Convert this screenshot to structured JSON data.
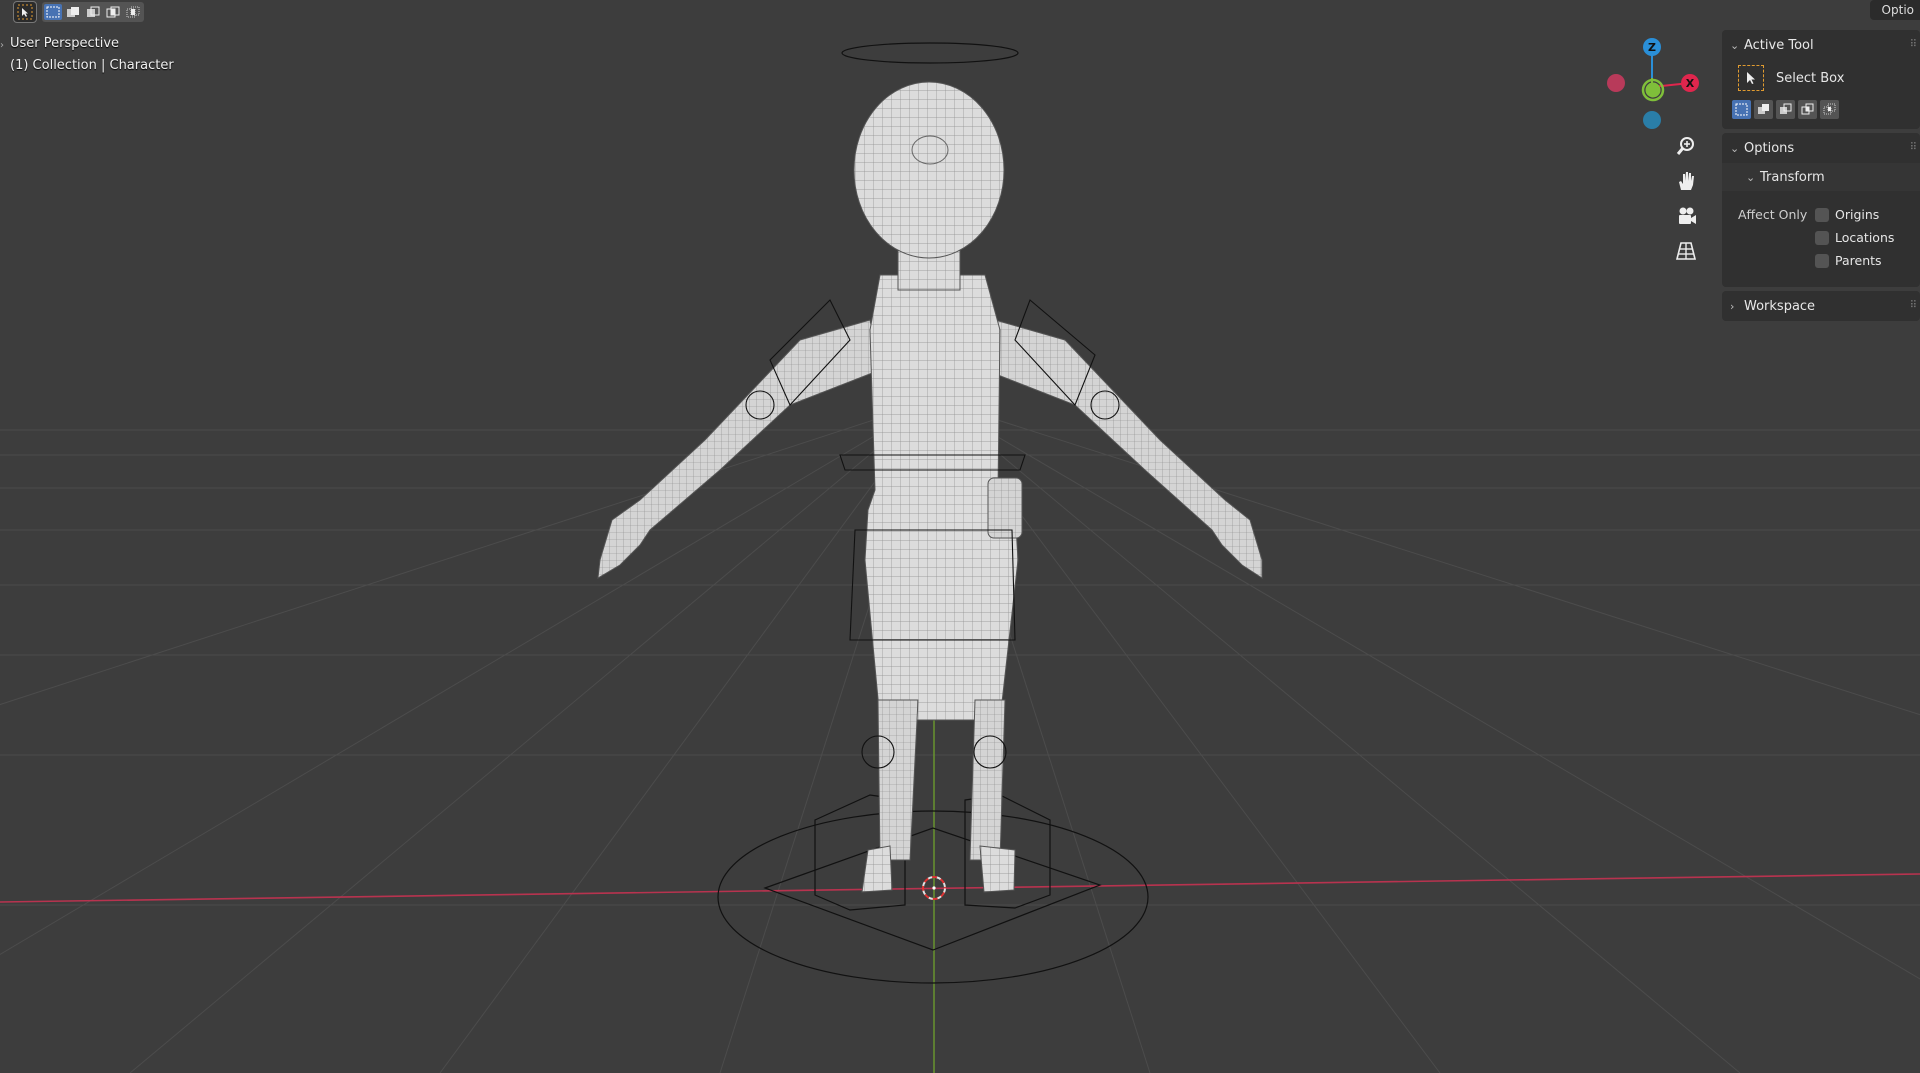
{
  "header": {
    "options_label": "Optio"
  },
  "overlay": {
    "view_name": "User Perspective",
    "collection_info": "(1) Collection | Character"
  },
  "gizmo": {
    "axes": {
      "z": "Z",
      "x": "X"
    },
    "colors": {
      "x": "#e0264d",
      "y": "#7fbf3a",
      "z": "#2a8fd8",
      "x_neg": "#b83a5a",
      "z_neg": "#2a7ea8"
    }
  },
  "navigation": {
    "icons": [
      "zoom-icon",
      "hand-pan-icon",
      "camera-icon",
      "perspective-grid-icon"
    ]
  },
  "sidebar": {
    "active_tool": {
      "title": "Active Tool",
      "tool_name": "Select Box"
    },
    "options": {
      "title": "Options",
      "transform": {
        "title": "Transform",
        "affect_only_label": "Affect Only",
        "checkboxes": [
          {
            "label": "Origins",
            "checked": false
          },
          {
            "label": "Locations",
            "checked": false
          },
          {
            "label": "Parents",
            "checked": false
          }
        ]
      }
    },
    "workspace": {
      "title": "Workspace"
    }
  },
  "colors": {
    "viewport_bg": "#3d3d3d",
    "grid": "#4a4a4a",
    "x_axis_line": "#b8334f",
    "y_axis_line": "#6b9a2d",
    "mesh_fill": "#d8d8d8",
    "accent": "#4772b3",
    "active_tool_border": "#e09b30"
  }
}
